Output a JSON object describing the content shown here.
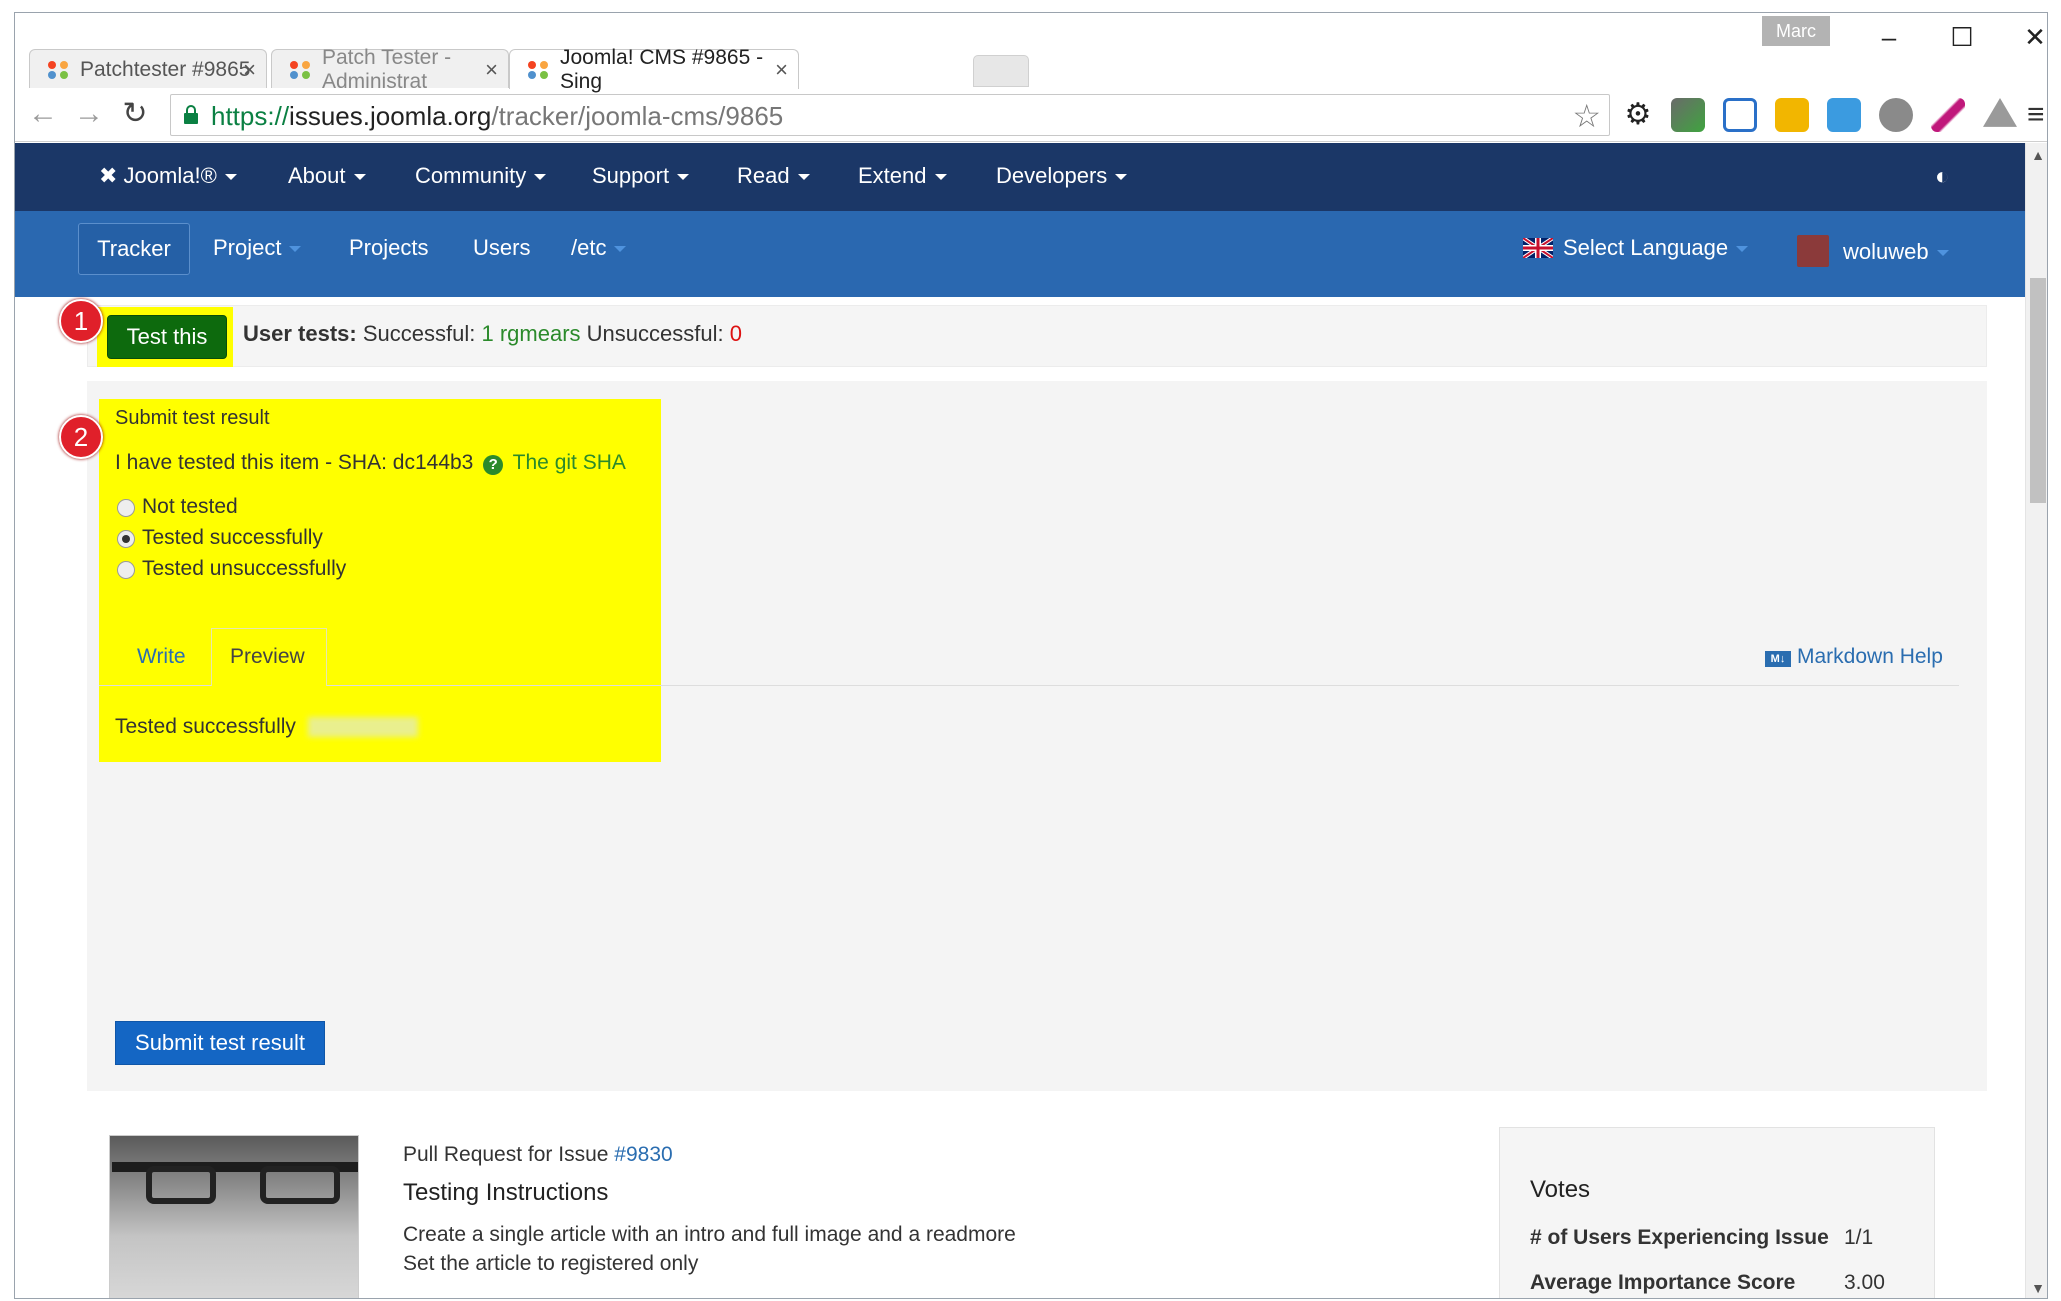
{
  "browser": {
    "tabs": [
      {
        "title": "Patchtester #9865"
      },
      {
        "title": "Patch Tester - Administrat"
      },
      {
        "title": "Joomla! CMS #9865 - Sing"
      }
    ],
    "profile_name": "Marc",
    "url_protocol": "https://",
    "url_host": "issues.joomla.org",
    "url_path": "/tracker/joomla-cms/9865"
  },
  "topnav": {
    "items": [
      "Joomla!®",
      "About",
      "Community",
      "Support",
      "Read",
      "Extend",
      "Developers"
    ]
  },
  "subnav": {
    "items": [
      "Tracker",
      "Project",
      "Projects",
      "Users",
      "/etc"
    ],
    "language": "Select Language",
    "user": "woluweb"
  },
  "test": {
    "badge1": "1",
    "button": "Test this",
    "label": "User tests:",
    "successful_label": "Successful:",
    "successful_count": "1",
    "successful_user": "rgmears",
    "unsuccessful_label": "Unsuccessful:",
    "unsuccessful_count": "0"
  },
  "form": {
    "badge2": "2",
    "heading": "Submit test result",
    "sha_text": "I have tested this item - SHA: dc144b3",
    "sha_help": "The git SHA",
    "options": [
      "Not tested",
      "Tested successfully",
      "Tested unsuccessfully"
    ],
    "selected": 1,
    "tab_write": "Write",
    "tab_preview": "Preview",
    "markdown_help": "Markdown Help",
    "preview_text": "Tested successfully",
    "submit": "Submit test result"
  },
  "issue": {
    "pr_text": "Pull Request for Issue",
    "pr_link": "#9830",
    "instructions_title": "Testing Instructions",
    "line1": "Create a single article with an intro and full image and a readmore",
    "line2": "Set the article to registered only"
  },
  "votes": {
    "title": "Votes",
    "row1_label": "# of Users Experiencing Issue",
    "row1_value": "1/1",
    "row2_label": "Average Importance Score",
    "row2_value": "3.00"
  },
  "colors": {
    "topnav": "#1b3767",
    "subnav": "#2a68b0",
    "highlight": "#ffff00",
    "success": "#2b8a2b",
    "danger": "#d11111"
  }
}
